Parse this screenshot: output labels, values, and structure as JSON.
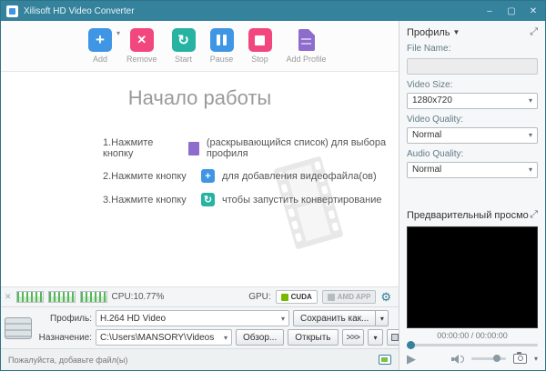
{
  "window": {
    "title": "Xilisoft HD Video Converter",
    "minimize": "–",
    "maximize": "▢",
    "close": "✕"
  },
  "toolbar": {
    "buttons": [
      {
        "label": "Add",
        "glyph": "+"
      },
      {
        "label": "Remove",
        "glyph": "✕"
      },
      {
        "label": "Start",
        "glyph": "↻"
      },
      {
        "label": "Pause"
      },
      {
        "label": "Stop"
      },
      {
        "label": "Add Profile"
      }
    ],
    "add_caret": "▼"
  },
  "getting_started": {
    "title": "Начало работы",
    "steps": [
      {
        "prefix": "1.Нажмите кнопку",
        "suffix": "(раскрывающийся список) для выбора профиля"
      },
      {
        "prefix": "2.Нажмите кнопку",
        "suffix": "для добавления видеофайла(ов)",
        "glyph": "+"
      },
      {
        "prefix": "3.Нажмите кнопку",
        "suffix": "чтобы запустить конвертирование",
        "glyph": "↻"
      }
    ]
  },
  "perf_bar": {
    "close": "✕",
    "cpu": "CPU:10.77%",
    "gpu_label": "GPU:",
    "cuda": "CUDA",
    "amd": "AMD APP",
    "gear": "⚙"
  },
  "output_panel": {
    "profile_label": "Профиль:",
    "profile_value": "H.264 HD Video",
    "save_as": "Сохранить как...",
    "caret": "▾",
    "destination_label": "Назначение:",
    "destination_value": "C:\\Users\\MANSORY\\Videos",
    "browse": "Обзор...",
    "open": "Открыть",
    "more": ">>>"
  },
  "status_bar": {
    "message": "Пожалуйста, добавьте файл(ы)"
  },
  "sidebar": {
    "profile_header": "Профиль",
    "header_caret": "▼",
    "expand_glyph": "⤢",
    "file_name_label": "File Name:",
    "file_name_value": "",
    "video_size_label": "Video Size:",
    "video_size_value": "1280x720",
    "video_quality_label": "Video Quality:",
    "video_quality_value": "Normal",
    "audio_quality_label": "Audio Quality:",
    "audio_quality_value": "Normal",
    "dd_caret": "▾",
    "preview_header": "Предварительный просмо",
    "time_display": "00:00:00 / 00:00:00",
    "play_glyph": "▶"
  }
}
